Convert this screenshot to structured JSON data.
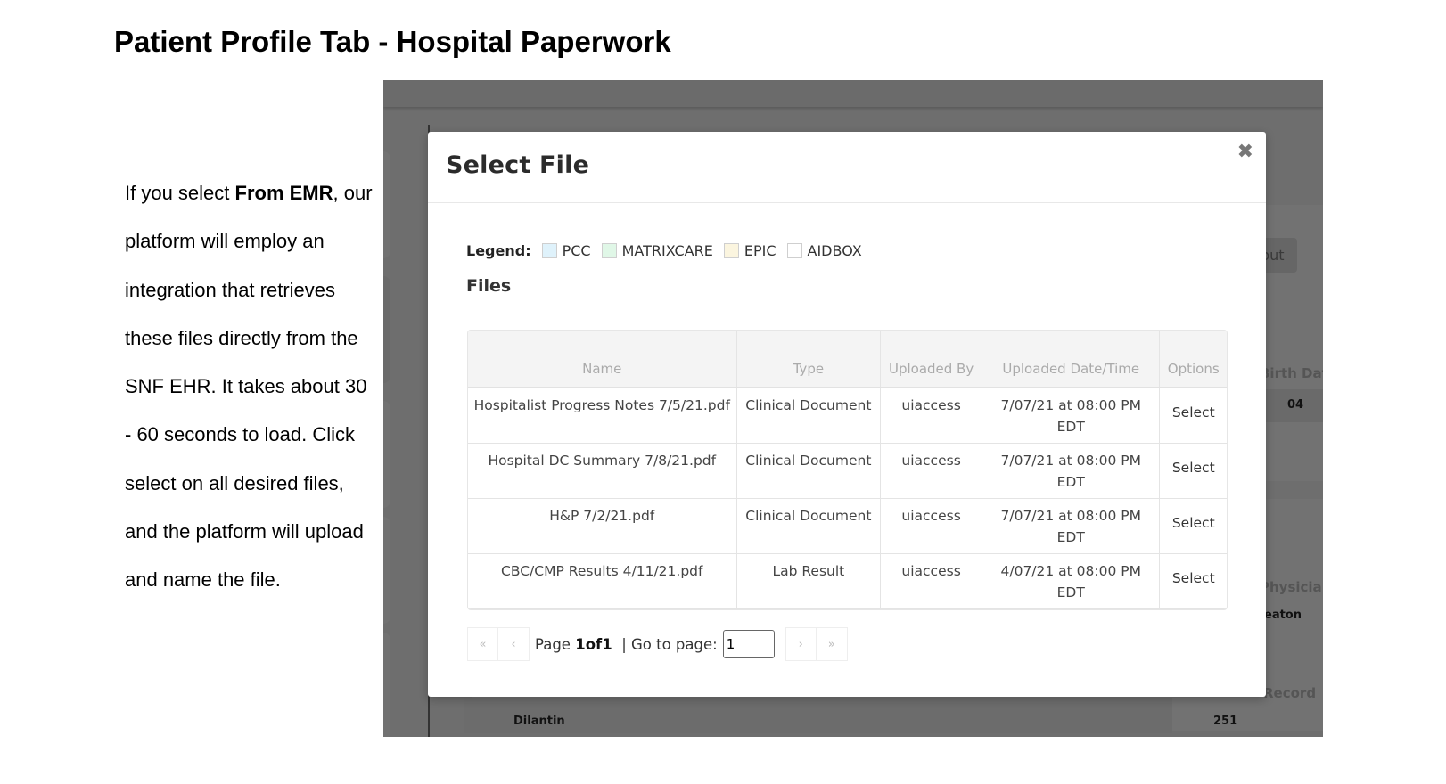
{
  "page": {
    "title": "Patient Profile Tab - Hospital Paperwork",
    "description": {
      "pre": "If you select ",
      "bold": "From EMR",
      "post": ", our platform will employ an integration that retrieves these files directly from the SNF EHR. It takes about 30 - 60 seconds to load. Click select on all desired files, and the platform will upload and name the file."
    }
  },
  "background": {
    "button_fragment": "put",
    "birth_date_label": "Birth Dat",
    "birth_date_value": "04",
    "physician_label": "Physicia",
    "physician_value": "eaton",
    "record_label": "Record",
    "medication": "Dilantin",
    "record_value": "251"
  },
  "modal": {
    "title": "Select File",
    "close_icon": "close-icon",
    "close_glyph": "✖",
    "legend": {
      "label": "Legend:",
      "items": [
        {
          "label": "PCC",
          "color": "#dff2fb"
        },
        {
          "label": "MATRIXCARE",
          "color": "#e0f7e7"
        },
        {
          "label": "EPIC",
          "color": "#fbf5df"
        },
        {
          "label": "AIDBOX",
          "color": "#ffffff"
        }
      ]
    },
    "files_heading": "Files",
    "table": {
      "headers": [
        "Name",
        "Type",
        "Uploaded By",
        "Uploaded Date/Time",
        "Options"
      ],
      "rows": [
        {
          "name": "Hospitalist Progress Notes 7/5/21.pdf",
          "type": "Clinical Document",
          "by": "uiaccess",
          "date": "7/07/21 at 08:00 PM EDT",
          "option": "Select"
        },
        {
          "name": "Hospital DC Summary 7/8/21.pdf",
          "type": "Clinical Document",
          "by": "uiaccess",
          "date": "7/07/21 at 08:00 PM EDT",
          "option": "Select"
        },
        {
          "name": "H&P 7/2/21.pdf",
          "type": "Clinical Document",
          "by": "uiaccess",
          "date": "7/07/21 at 08:00 PM EDT",
          "option": "Select"
        },
        {
          "name": "CBC/CMP Results 4/11/21.pdf",
          "type": "Lab Result",
          "by": "uiaccess",
          "date": "4/07/21 at 08:00 PM EDT",
          "option": "Select"
        }
      ]
    },
    "pagination": {
      "first": "«",
      "prev": "‹",
      "page_prefix": "Page",
      "page_current": "1",
      "page_of": "of",
      "page_total": "1",
      "goto_label": "| Go to page:",
      "goto_value": "1",
      "next": "›",
      "last": "»"
    }
  }
}
